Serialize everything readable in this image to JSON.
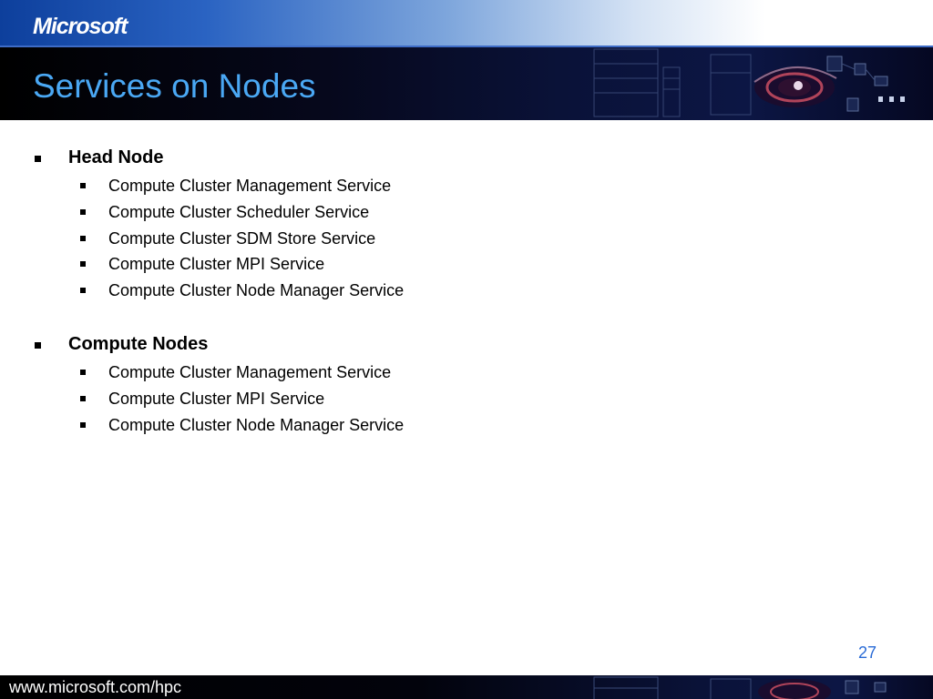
{
  "header": {
    "logo_text": "Microsoft",
    "title": "Services on Nodes"
  },
  "sections": [
    {
      "heading": "Head Node",
      "items": [
        "Compute Cluster Management Service",
        "Compute Cluster Scheduler Service",
        "Compute Cluster SDM Store Service",
        "Compute Cluster MPI Service",
        "Compute Cluster Node Manager Service"
      ]
    },
    {
      "heading": "Compute Nodes",
      "items": [
        "Compute Cluster Management Service",
        "Compute Cluster MPI Service",
        "Compute Cluster Node Manager Service"
      ]
    }
  ],
  "page_number": "27",
  "footer": {
    "url": "www.microsoft.com/hpc"
  },
  "colors": {
    "title": "#4aa8f4",
    "page_number": "#2a6bd6",
    "header_blue": "#0d3f9c",
    "text": "#000000"
  }
}
